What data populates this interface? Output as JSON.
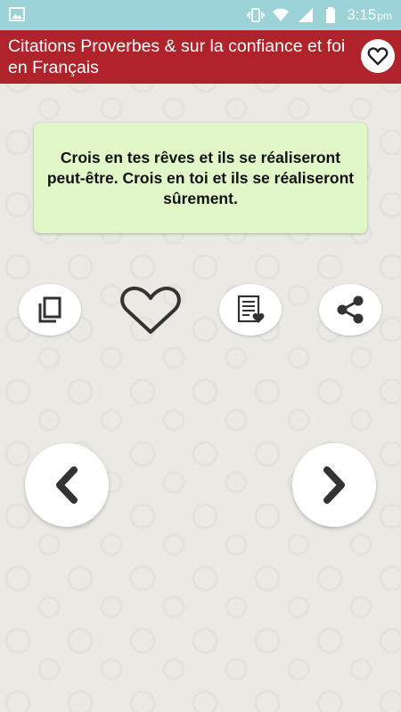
{
  "status_bar": {
    "time": "3:15",
    "ampm": "pm",
    "icons": [
      "image-icon",
      "vibrate-icon",
      "wifi-icon",
      "signal-icon",
      "battery-icon"
    ]
  },
  "app_bar": {
    "title": "Citations Proverbes & sur la confiance et foi en Français",
    "favorites_icon": "heart-outline-icon"
  },
  "quote": {
    "text": "Crois en tes rêves et ils se réaliseront peut-être. Crois en toi et ils se réaliseront sûrement."
  },
  "actions": [
    "copy-icon",
    "heart-outline-icon",
    "favorites-list-icon",
    "share-icon"
  ],
  "navigation": [
    "chevron-left-icon",
    "chevron-right-icon"
  ],
  "colors": {
    "status_bar": "#9bd3d9",
    "app_bar": "#b0232a",
    "background": "#eae9e4",
    "quote_card": "#e1f7c8",
    "icon": "#333333"
  }
}
